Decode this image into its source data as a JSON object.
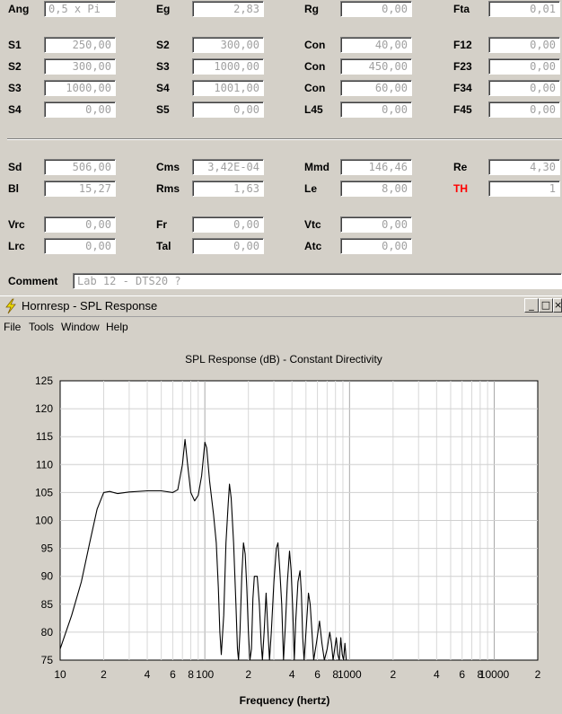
{
  "form": {
    "row1": [
      {
        "label": "Ang",
        "value": "0,5 x Pi",
        "left": true
      },
      {
        "label": "Eg",
        "value": "2,83"
      },
      {
        "label": "Rg",
        "value": "0,00"
      },
      {
        "label": "Fta",
        "value": "0,01"
      }
    ],
    "rows": [
      [
        {
          "label": "S1",
          "value": "250,00"
        },
        {
          "label": "S2",
          "value": "300,00"
        },
        {
          "label": "Con",
          "value": "40,00"
        },
        {
          "label": "F12",
          "value": "0,00"
        }
      ],
      [
        {
          "label": "S2",
          "value": "300,00"
        },
        {
          "label": "S3",
          "value": "1000,00"
        },
        {
          "label": "Con",
          "value": "450,00"
        },
        {
          "label": "F23",
          "value": "0,00"
        }
      ],
      [
        {
          "label": "S3",
          "value": "1000,00"
        },
        {
          "label": "S4",
          "value": "1001,00"
        },
        {
          "label": "Con",
          "value": "60,00"
        },
        {
          "label": "F34",
          "value": "0,00"
        }
      ],
      [
        {
          "label": "S4",
          "value": "0,00"
        },
        {
          "label": "S5",
          "value": "0,00"
        },
        {
          "label": "L45",
          "value": "0,00"
        },
        {
          "label": "F45",
          "value": "0,00"
        }
      ]
    ],
    "driver1": [
      {
        "label": "Sd",
        "value": "506,00"
      },
      {
        "label": "Cms",
        "value": "3,42E-04"
      },
      {
        "label": "Mmd",
        "value": "146,46"
      },
      {
        "label": "Re",
        "value": "4,30"
      }
    ],
    "driver2": [
      {
        "label": "Bl",
        "value": "15,27"
      },
      {
        "label": "Rms",
        "value": "1,63"
      },
      {
        "label": "Le",
        "value": "8,00"
      },
      {
        "label": "TH",
        "value": "1",
        "red": true
      }
    ],
    "chamber1": [
      {
        "label": "Vrc",
        "value": "0,00"
      },
      {
        "label": "Fr",
        "value": "0,00"
      },
      {
        "label": "Vtc",
        "value": "0,00"
      }
    ],
    "chamber2": [
      {
        "label": "Lrc",
        "value": "0,00"
      },
      {
        "label": "Tal",
        "value": "0,00"
      },
      {
        "label": "Atc",
        "value": "0,00"
      }
    ],
    "comment_label": "Comment",
    "comment_value": "Lab 12 - DTS20 ?"
  },
  "window": {
    "title": "Hornresp - SPL Response",
    "minimize": "_",
    "maximize": "□",
    "close": "×"
  },
  "menu": [
    "File",
    "Tools",
    "Window",
    "Help"
  ],
  "colors": {
    "th_label": "#ff0000",
    "field_text": "#a0a0a0",
    "background": "#d4d0c8"
  },
  "chart_data": {
    "type": "line",
    "title": "SPL Response (dB) - Constant Directivity",
    "xlabel": "Frequency (hertz)",
    "ylabel": "",
    "x_scale": "log",
    "xlim": [
      10,
      20000
    ],
    "ylim": [
      75,
      125
    ],
    "y_ticks": [
      75,
      80,
      85,
      90,
      95,
      100,
      105,
      110,
      115,
      120,
      125
    ],
    "x_tick_labels": [
      {
        "x": 10,
        "label": "10"
      },
      {
        "x": 20,
        "label": "2"
      },
      {
        "x": 40,
        "label": "4"
      },
      {
        "x": 60,
        "label": "6"
      },
      {
        "x": 80,
        "label": "8"
      },
      {
        "x": 100,
        "label": "100"
      },
      {
        "x": 200,
        "label": "2"
      },
      {
        "x": 400,
        "label": "4"
      },
      {
        "x": 600,
        "label": "6"
      },
      {
        "x": 800,
        "label": "8"
      },
      {
        "x": 1000,
        "label": "1000"
      },
      {
        "x": 2000,
        "label": "2"
      },
      {
        "x": 4000,
        "label": "4"
      },
      {
        "x": 6000,
        "label": "6"
      },
      {
        "x": 8000,
        "label": "8"
      },
      {
        "x": 10000,
        "label": "10000"
      },
      {
        "x": 20000,
        "label": "2"
      }
    ],
    "grid": true,
    "series": [
      {
        "points": [
          [
            10,
            77
          ],
          [
            12,
            83
          ],
          [
            14,
            89
          ],
          [
            16,
            96
          ],
          [
            18,
            102
          ],
          [
            20,
            105
          ],
          [
            22,
            105.2
          ],
          [
            25,
            104.8
          ],
          [
            30,
            105.1
          ],
          [
            40,
            105.3
          ],
          [
            50,
            105.3
          ],
          [
            60,
            105
          ],
          [
            65,
            105.5
          ],
          [
            70,
            110
          ],
          [
            73,
            114.5
          ],
          [
            76,
            110
          ],
          [
            80,
            105
          ],
          [
            85,
            103.5
          ],
          [
            90,
            104.5
          ],
          [
            95,
            108
          ],
          [
            100,
            114
          ],
          [
            103,
            113
          ],
          [
            108,
            107
          ],
          [
            115,
            101
          ],
          [
            120,
            96
          ],
          [
            124,
            88
          ],
          [
            127,
            80
          ],
          [
            130,
            76
          ],
          [
            135,
            83
          ],
          [
            140,
            96
          ],
          [
            145,
            103
          ],
          [
            148,
            106.5
          ],
          [
            152,
            104
          ],
          [
            158,
            96
          ],
          [
            164,
            85
          ],
          [
            168,
            77
          ],
          [
            171,
            75
          ],
          [
            175,
            80
          ],
          [
            180,
            90
          ],
          [
            185,
            96
          ],
          [
            190,
            94
          ],
          [
            195,
            88
          ],
          [
            200,
            80
          ],
          [
            205,
            75
          ],
          [
            210,
            77
          ],
          [
            215,
            86
          ],
          [
            220,
            90
          ],
          [
            230,
            90
          ],
          [
            238,
            85
          ],
          [
            245,
            78
          ],
          [
            250,
            75
          ],
          [
            257,
            80
          ],
          [
            265,
            87
          ],
          [
            272,
            81
          ],
          [
            280,
            75
          ],
          [
            288,
            80
          ],
          [
            300,
            89
          ],
          [
            312,
            95
          ],
          [
            320,
            96
          ],
          [
            330,
            91
          ],
          [
            340,
            85
          ],
          [
            350,
            75
          ],
          [
            360,
            81
          ],
          [
            372,
            89
          ],
          [
            385,
            94.5
          ],
          [
            395,
            91
          ],
          [
            405,
            84
          ],
          [
            415,
            75
          ],
          [
            425,
            82
          ],
          [
            440,
            89
          ],
          [
            455,
            91
          ],
          [
            465,
            87
          ],
          [
            475,
            79
          ],
          [
            485,
            75
          ],
          [
            500,
            80
          ],
          [
            520,
            87
          ],
          [
            535,
            85
          ],
          [
            550,
            80
          ],
          [
            565,
            75
          ],
          [
            590,
            78
          ],
          [
            620,
            82
          ],
          [
            645,
            78
          ],
          [
            670,
            75
          ],
          [
            700,
            77
          ],
          [
            730,
            80
          ],
          [
            750,
            78
          ],
          [
            770,
            75
          ],
          [
            790,
            77
          ],
          [
            810,
            79
          ],
          [
            830,
            76
          ],
          [
            850,
            75
          ],
          [
            870,
            79
          ],
          [
            890,
            76
          ],
          [
            910,
            75
          ],
          [
            930,
            78
          ],
          [
            950,
            75
          ]
        ]
      }
    ]
  }
}
